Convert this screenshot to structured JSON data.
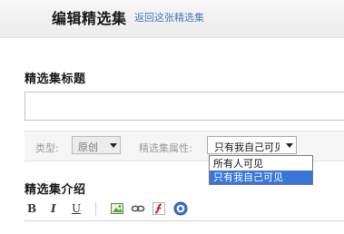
{
  "header": {
    "title": "编辑精选集",
    "back_link": "返回这张精选集"
  },
  "title_section": {
    "label": "精选集标题",
    "input_value": ""
  },
  "options": {
    "type_label": "类型:",
    "type_value": "原创",
    "attr_label": "精选集属性:",
    "attr_value": "只有我自己可见",
    "attr_options": [
      "所有人可见",
      "只有我自己可见"
    ],
    "attr_highlighted": "只有我自己可见"
  },
  "intro_section": {
    "label": "精选集介绍"
  },
  "editor_toolbar": {
    "bold": "B",
    "italic": "I",
    "underline": "U",
    "icons": [
      "image-icon",
      "link-icon",
      "flash-icon",
      "help-icon"
    ]
  },
  "colors": {
    "link": "#4a7ab8",
    "highlight": "#3875d7"
  }
}
